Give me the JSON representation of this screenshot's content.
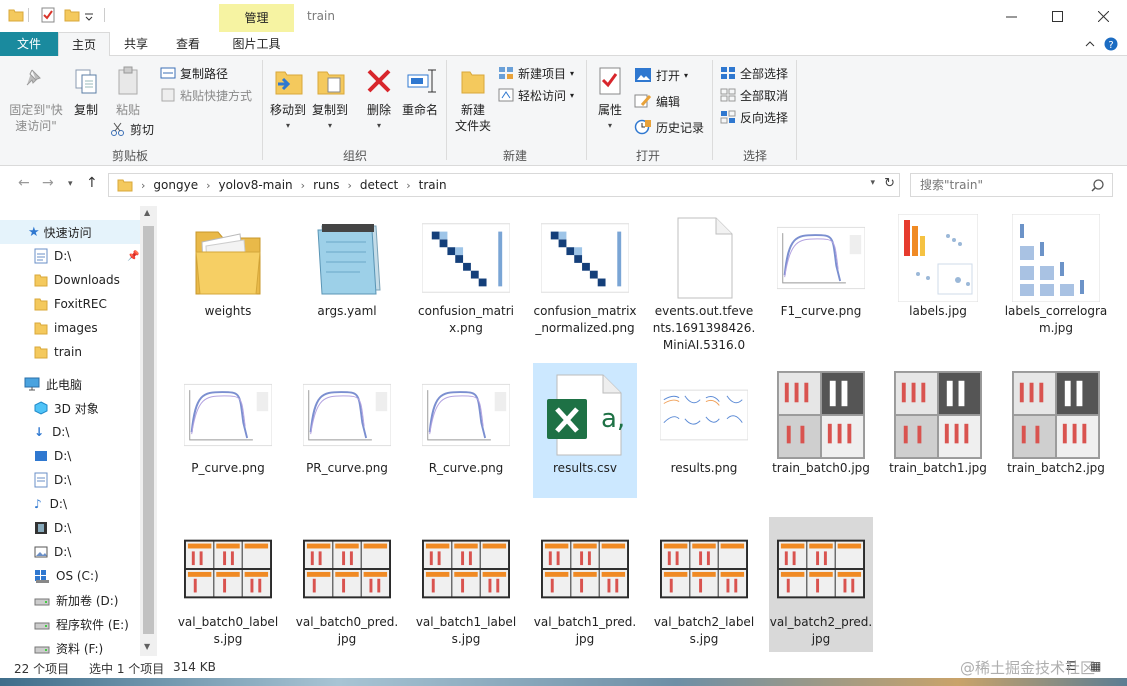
{
  "window": {
    "title": "train",
    "contextual_tab": "管理",
    "controls": [
      "minimize-icon",
      "maximize-icon",
      "close-icon"
    ]
  },
  "ribbon_tabs": [
    "文件",
    "主页",
    "共享",
    "查看",
    "图片工具"
  ],
  "ribbon": {
    "clipboard": {
      "group_label": "剪贴板",
      "pin_label_1": "固定到\"快",
      "pin_label_2": "速访问\"",
      "copy": "复制",
      "paste": "粘贴",
      "copy_path": "复制路径",
      "paste_shortcut": "粘贴快捷方式",
      "cut": "剪切"
    },
    "organize": {
      "group_label": "组织",
      "move_to": "移动到",
      "copy_to": "复制到",
      "delete": "删除",
      "rename": "重命名"
    },
    "new": {
      "group_label": "新建",
      "new_folder_1": "新建",
      "new_folder_2": "文件夹",
      "new_item": "新建项目",
      "easy_access": "轻松访问"
    },
    "open": {
      "group_label": "打开",
      "properties": "属性",
      "open": "打开",
      "edit": "编辑",
      "history": "历史记录"
    },
    "select": {
      "group_label": "选择",
      "select_all": "全部选择",
      "select_none": "全部取消",
      "invert": "反向选择"
    }
  },
  "address": {
    "crumbs": [
      "gongye",
      "yolov8-main",
      "runs",
      "detect",
      "train"
    ],
    "search_placeholder": "搜索\"train\""
  },
  "nav": {
    "quick_access": "快速访问",
    "items": [
      "D:\\",
      "Downloads",
      "FoxitREC",
      "images",
      "train"
    ],
    "this_pc": "此电脑",
    "pc_items": [
      "3D 对象",
      "D:\\",
      "D:\\",
      "D:\\",
      "D:\\",
      "D:\\",
      "D:\\",
      "OS (C:)",
      "新加卷 (D:)",
      "程序软件 (E:)",
      "资料 (F:)"
    ]
  },
  "files": [
    {
      "name": "weights",
      "type": "folder"
    },
    {
      "name": "args.yaml",
      "type": "notepad"
    },
    {
      "name": "confusion_matrix.png",
      "type": "matrix"
    },
    {
      "name": "confusion_matrix_normalized.png",
      "type": "matrix"
    },
    {
      "name": "events.out.tfevents.1691398426.MiniAI.5316.0",
      "type": "blank"
    },
    {
      "name": "F1_curve.png",
      "type": "curve"
    },
    {
      "name": "labels.jpg",
      "type": "labels"
    },
    {
      "name": "labels_correlogram.jpg",
      "type": "correlogram"
    },
    {
      "name": "P_curve.png",
      "type": "curve"
    },
    {
      "name": "PR_curve.png",
      "type": "curve"
    },
    {
      "name": "R_curve.png",
      "type": "curve"
    },
    {
      "name": "results.csv",
      "type": "excel"
    },
    {
      "name": "results.png",
      "type": "results"
    },
    {
      "name": "train_batch0.jpg",
      "type": "batch"
    },
    {
      "name": "train_batch1.jpg",
      "type": "batch"
    },
    {
      "name": "train_batch2.jpg",
      "type": "batch"
    },
    {
      "name": "val_batch0_labels.jpg",
      "type": "val"
    },
    {
      "name": "val_batch0_pred.jpg",
      "type": "val"
    },
    {
      "name": "val_batch1_labels.jpg",
      "type": "val"
    },
    {
      "name": "val_batch1_pred.jpg",
      "type": "val"
    },
    {
      "name": "val_batch2_labels.jpg",
      "type": "val"
    },
    {
      "name": "val_batch2_pred.jpg",
      "type": "val"
    }
  ],
  "status": {
    "count": "22 个项目",
    "selected": "选中 1 个项目",
    "size": "314 KB"
  },
  "watermark": "@稀土掘金技术社区",
  "colors": {
    "file_tab": "#1a8a9e",
    "manage_tab": "#f6f3a2",
    "selection": "#cce8ff",
    "excel_green": "#1e7145"
  }
}
